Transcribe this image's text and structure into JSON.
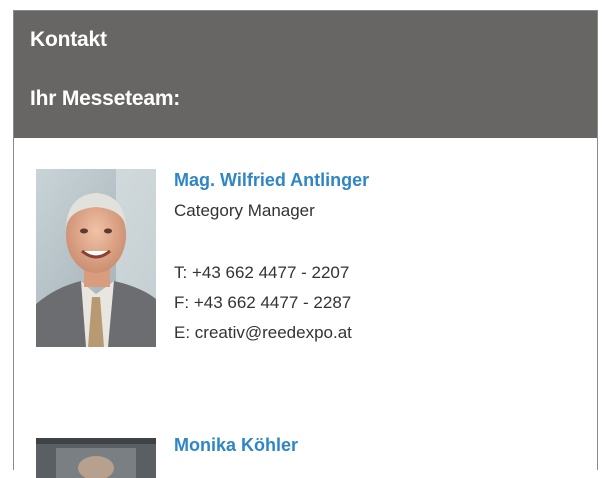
{
  "panel": {
    "title": "Kontakt",
    "subtitle": "Ihr Messeteam:"
  },
  "contacts": [
    {
      "name": "Mag. Wilfried Antlinger",
      "role": "Category Manager",
      "phone": "T: +43 662 4477 - 2207",
      "fax": "F: +43 662 4477 - 2287",
      "email": "E: creativ@reedexpo.at"
    },
    {
      "name": "Monika Köhler"
    }
  ],
  "colors": {
    "header_bg": "#686664",
    "link": "#2f86c6"
  }
}
